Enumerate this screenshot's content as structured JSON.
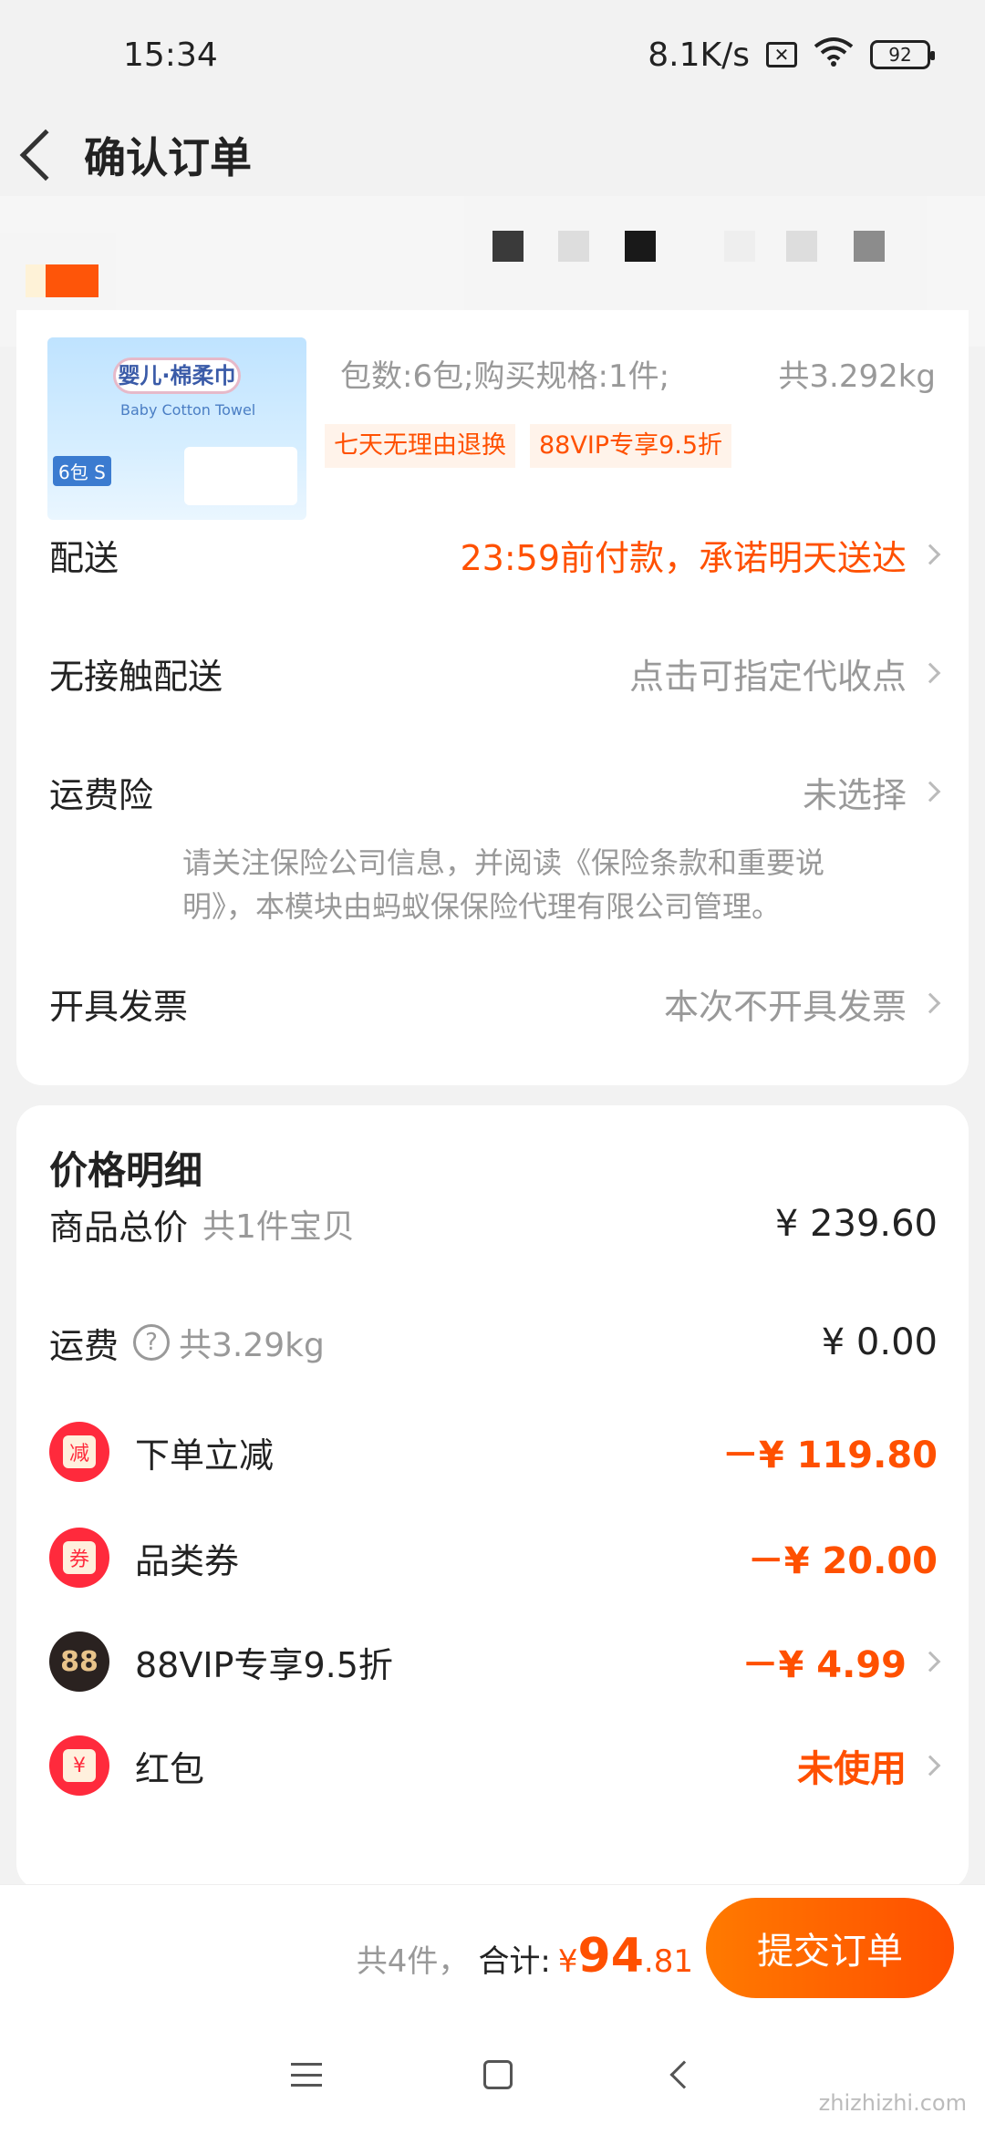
{
  "status_bar": {
    "time": "15:34",
    "net_speed": "8.1K/s",
    "battery": "92"
  },
  "nav": {
    "title": "确认订单"
  },
  "goods": {
    "img_brand": "婴儿·棉柔巾",
    "img_sub": "Baby Cotton Towel",
    "img_pack": "6包 S",
    "spec": "包数:6包;购买规格:1件;",
    "weight": "共3.292kg",
    "tags": [
      "七天无理由退换",
      "88VIP专享9.5折"
    ]
  },
  "rows": {
    "delivery": {
      "label": "配送",
      "value": "23:59前付款，承诺明天送达"
    },
    "contactless": {
      "label": "无接触配送",
      "value": "点击可指定代收点"
    },
    "shipping_insurance": {
      "label": "运费险",
      "value": "未选择",
      "note": "请关注保险公司信息，并阅读《保险条款和重要说明》，本模块由蚂蚁保保险代理有限公司管理。"
    },
    "invoice": {
      "label": "开具发票",
      "value": "本次不开具发票"
    }
  },
  "price": {
    "title": "价格明细",
    "total": {
      "label": "商品总价",
      "note": "共1件宝贝",
      "value": "¥ 239.60"
    },
    "freight": {
      "label": "运费",
      "note": "共3.29kg",
      "value": "¥ 0.00"
    },
    "discounts": [
      {
        "icon": "减",
        "label": "下单立减",
        "value": "－¥ 119.80"
      },
      {
        "icon": "券",
        "label": "品类券",
        "value": "－¥ 20.00"
      },
      {
        "icon": "88",
        "label": "88VIP专享9.5折",
        "value": "－¥ 4.99"
      },
      {
        "icon": "¥",
        "label": "红包",
        "value": "未使用"
      }
    ]
  },
  "bottom": {
    "count": "共4件，",
    "total_label": "合计:",
    "yen": "¥",
    "amount_int": "94",
    "amount_dec": ".81",
    "submit": "提交订单"
  },
  "watermark": "zhizhizhi.com"
}
